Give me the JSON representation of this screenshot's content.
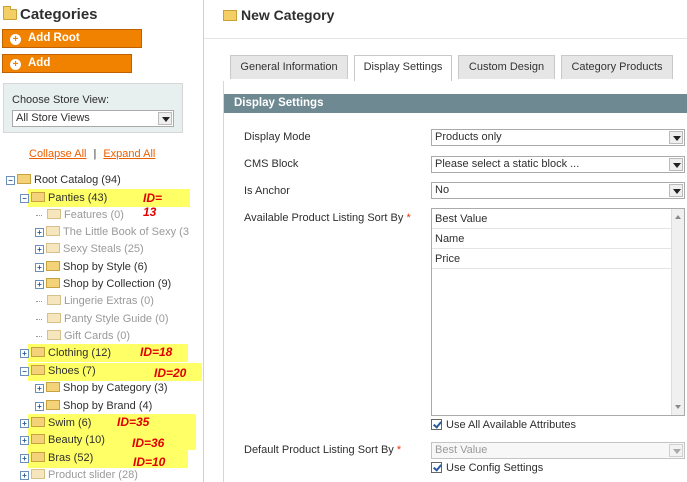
{
  "categories_panel": {
    "title": "Categories",
    "add_root_label": "Add Root Category",
    "add_sub_label": "Add Subcategory",
    "store_view_label": "Choose Store View:",
    "store_view_value": "All Store Views",
    "collapse_all": "Collapse All",
    "separator": "|",
    "expand_all": "Expand All"
  },
  "tree": [
    {
      "label": "Root Catalog (94)",
      "enabled": true
    },
    {
      "label": "Panties (43)",
      "enabled": true,
      "highlight": true,
      "id_note": "ID= 13"
    },
    {
      "label": "Features (0)",
      "enabled": false
    },
    {
      "label": "The Little Book of Sexy (3",
      "enabled": false
    },
    {
      "label": "Sexy Steals (25)",
      "enabled": false
    },
    {
      "label": "Shop by Style (6)",
      "enabled": true
    },
    {
      "label": "Shop by Collection (9)",
      "enabled": true
    },
    {
      "label": "Lingerie Extras (0)",
      "enabled": false
    },
    {
      "label": "Panty Style Guide (0)",
      "enabled": false
    },
    {
      "label": "Gift Cards (0)",
      "enabled": false
    },
    {
      "label": "Clothing (12)",
      "enabled": true,
      "highlight": true,
      "id_note": "ID=18"
    },
    {
      "label": "Shoes (7)",
      "enabled": true,
      "highlight": true,
      "id_note": "ID=20"
    },
    {
      "label": "Shop by Category (3)",
      "enabled": true
    },
    {
      "label": "Shop by Brand (4)",
      "enabled": true
    },
    {
      "label": "Swim (6)",
      "enabled": true,
      "highlight": true,
      "id_note": "ID=35"
    },
    {
      "label": "Beauty (10)",
      "enabled": true,
      "highlight": true,
      "id_note": "ID=36"
    },
    {
      "label": "Bras (52)",
      "enabled": true,
      "highlight": true,
      "id_note": "ID=10"
    },
    {
      "label": "Product slider (28)",
      "enabled": false
    }
  ],
  "main": {
    "title": "New Category",
    "tabs": [
      {
        "label": "General Information",
        "active": false
      },
      {
        "label": "Display Settings",
        "active": true
      },
      {
        "label": "Custom Design",
        "active": false
      },
      {
        "label": "Category Products",
        "active": false
      }
    ],
    "section_title": "Display Settings",
    "fields": {
      "display_mode": {
        "label": "Display Mode",
        "value": "Products only"
      },
      "cms_block": {
        "label": "CMS Block",
        "value": "Please select a static block ..."
      },
      "is_anchor": {
        "label": "Is Anchor",
        "value": "No"
      },
      "sort_by": {
        "label": "Available Product Listing Sort By",
        "required_mark": "*",
        "options": [
          "Best Value",
          "Name",
          "Price"
        ],
        "use_all_label": "Use All Available Attributes",
        "use_all_checked": true
      },
      "default_sort": {
        "label": "Default Product Listing Sort By",
        "required_mark": "*",
        "value": "Best Value",
        "disabled": true,
        "use_config_label": "Use Config Settings",
        "use_config_checked": true
      }
    }
  },
  "colors": {
    "accent_orange": "#f18200",
    "link_orange": "#eb5e00",
    "section_header": "#6f8992",
    "highlight_yellow": "#ffff66",
    "id_red": "#e00000"
  }
}
